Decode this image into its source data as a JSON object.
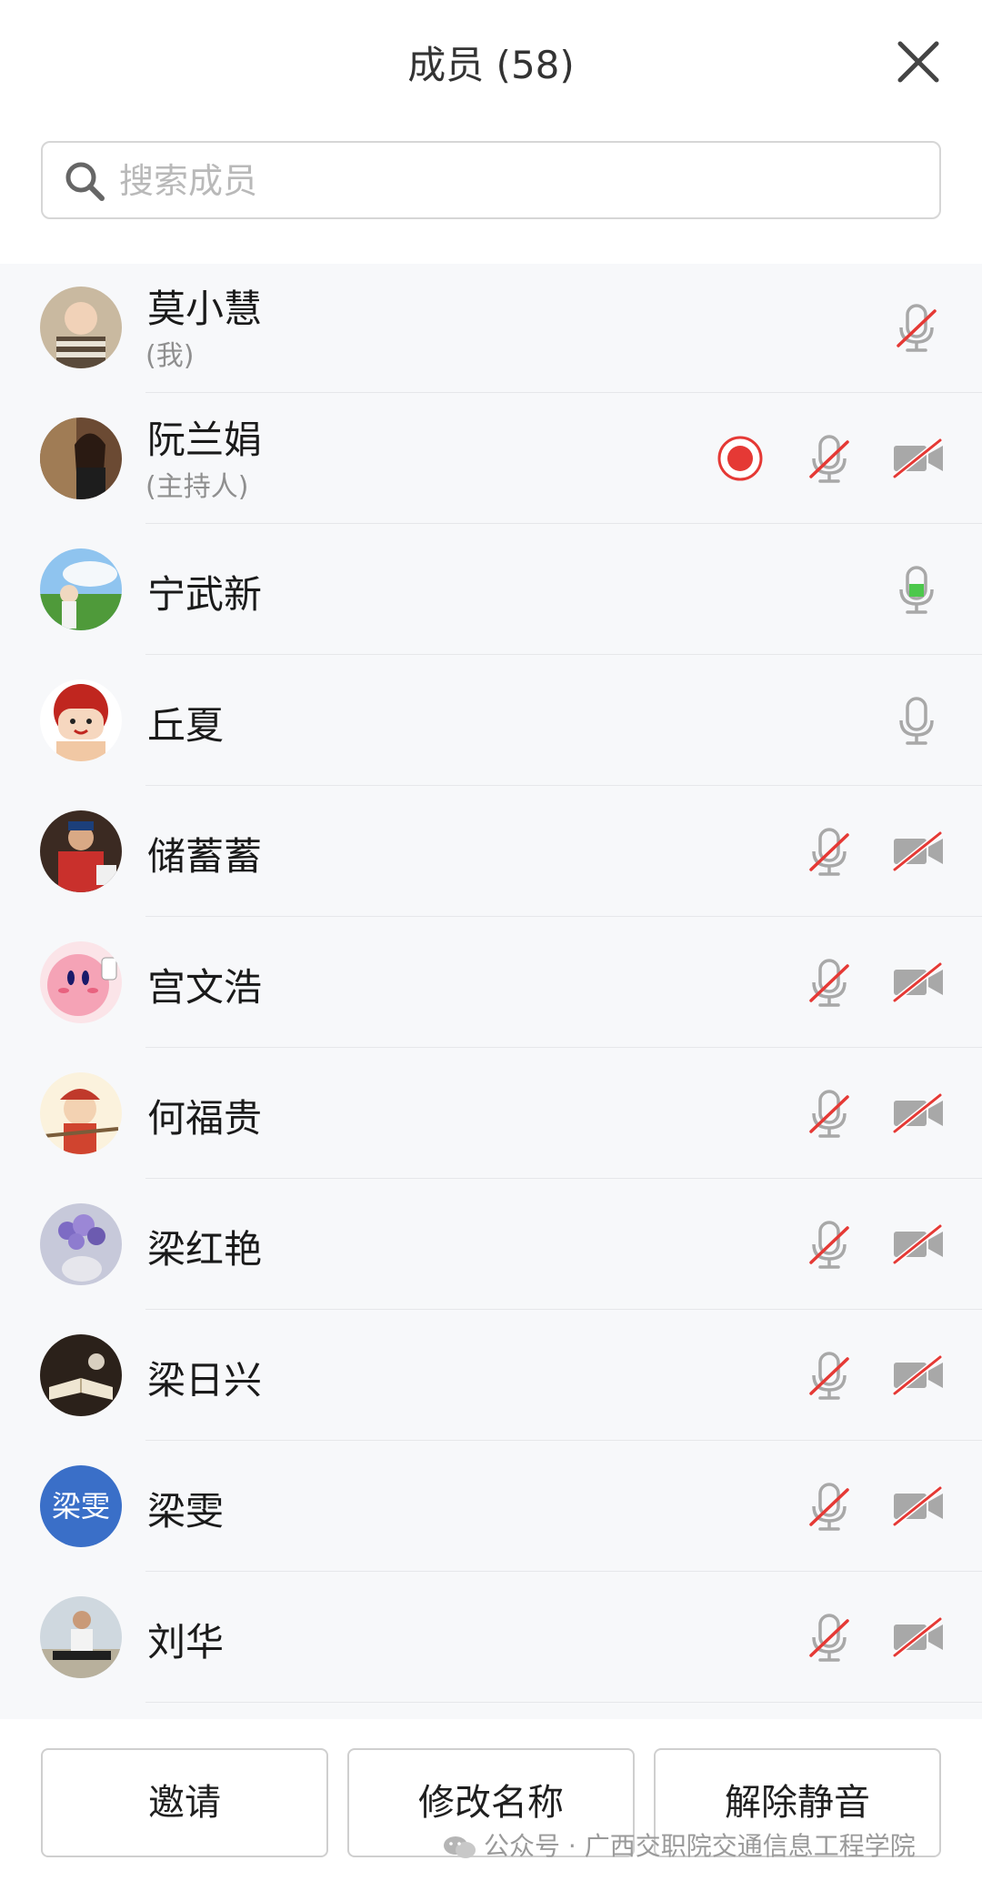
{
  "header": {
    "title": "成员 (58)",
    "search_placeholder": "搜索成员"
  },
  "members": [
    {
      "name": "莫小慧",
      "role": "(我)",
      "avatar": "photo-child",
      "recording": false,
      "mic": "muted",
      "camera": "none"
    },
    {
      "name": "阮兰娟",
      "role": "(主持人)",
      "avatar": "photo-woman",
      "recording": true,
      "mic": "muted",
      "camera": "off"
    },
    {
      "name": "宁武新",
      "role": "",
      "avatar": "photo-field",
      "recording": false,
      "mic": "speaking",
      "camera": "none"
    },
    {
      "name": "丘夏",
      "role": "",
      "avatar": "cartoon-girl",
      "recording": false,
      "mic": "on",
      "camera": "none"
    },
    {
      "name": "储蓄蓄",
      "role": "",
      "avatar": "photo-person-red",
      "recording": false,
      "mic": "muted",
      "camera": "off"
    },
    {
      "name": "宫文浩",
      "role": "",
      "avatar": "cartoon-kirby",
      "recording": false,
      "mic": "muted",
      "camera": "off"
    },
    {
      "name": "何福贵",
      "role": "",
      "avatar": "cartoon-warrior",
      "recording": false,
      "mic": "muted",
      "camera": "off"
    },
    {
      "name": "梁红艳",
      "role": "",
      "avatar": "photo-flowers",
      "recording": false,
      "mic": "muted",
      "camera": "off"
    },
    {
      "name": "梁日兴",
      "role": "",
      "avatar": "photo-book",
      "recording": false,
      "mic": "muted",
      "camera": "off"
    },
    {
      "name": "梁雯",
      "role": "",
      "avatar": "text",
      "avatar_text": "梁雯",
      "recording": false,
      "mic": "muted",
      "camera": "off"
    },
    {
      "name": "刘华",
      "role": "",
      "avatar": "photo-man",
      "recording": false,
      "mic": "muted",
      "camera": "off"
    }
  ],
  "footer": {
    "invite_label": "邀请",
    "rename_label": "修改名称",
    "unmute_label": "解除静音",
    "watermark": "公众号 · 广西交职院交通信息工程学院"
  },
  "colors": {
    "accent_red": "#e53935",
    "speaking_green": "#4cc84c",
    "icon_gray": "#a8a8a8",
    "text_avatar_blue": "#3a6fc8"
  }
}
